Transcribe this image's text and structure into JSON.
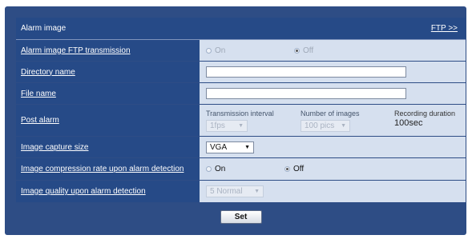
{
  "header": {
    "title": "Alarm image",
    "ftp_link": "FTP >>"
  },
  "rows": {
    "ftp_transmission": {
      "label": "Alarm image FTP transmission",
      "options": [
        "On",
        "Off"
      ],
      "selected": "Off",
      "enabled": false
    },
    "directory_name": {
      "label": "Directory name",
      "value": ""
    },
    "file_name": {
      "label": "File name",
      "value": ""
    },
    "post_alarm": {
      "label": "Post alarm",
      "transmission_interval": {
        "title": "Transmission interval",
        "value": "1fps"
      },
      "number_of_images": {
        "title": "Number of images",
        "value": "100 pics"
      },
      "recording_duration": {
        "title": "Recording duration",
        "value": "100sec"
      }
    },
    "capture_size": {
      "label": "Image capture size",
      "value": "VGA"
    },
    "compression": {
      "label": "Image compression rate upon alarm detection",
      "options": [
        "On",
        "Off"
      ],
      "selected": "Off"
    },
    "quality": {
      "label": "Image quality upon alarm detection",
      "value": "5 Normal"
    }
  },
  "footer": {
    "set_label": "Set"
  }
}
